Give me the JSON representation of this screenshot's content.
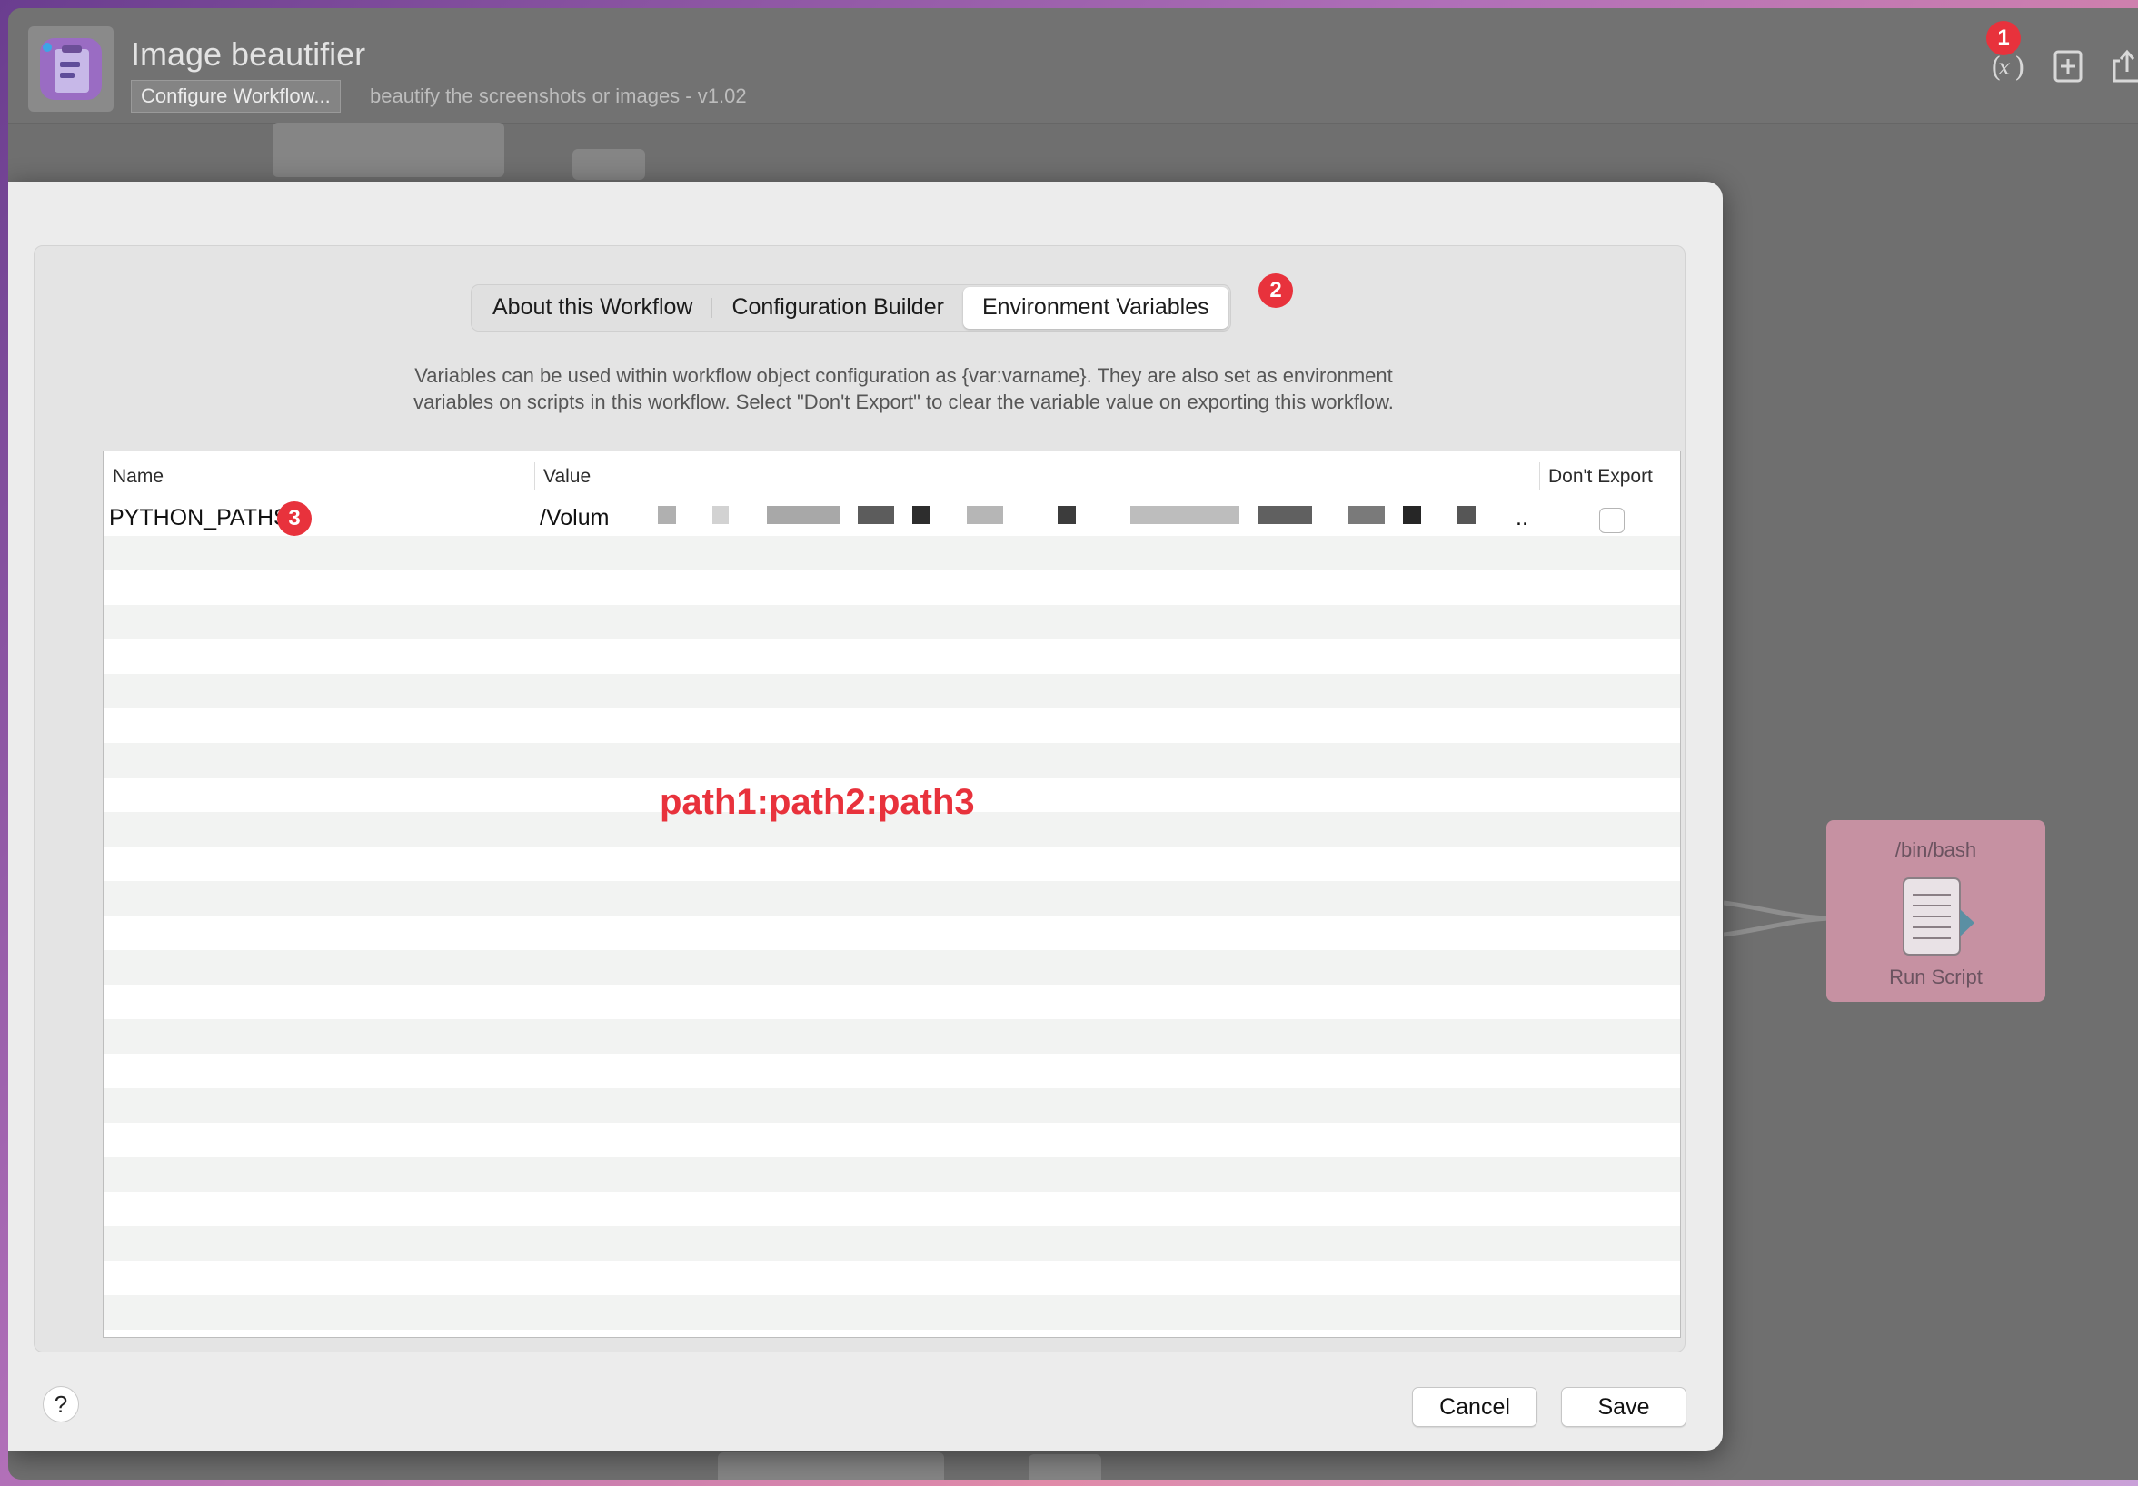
{
  "window": {
    "title": "Image beautifier",
    "configure_button": "Configure Workflow...",
    "subtitle": "beautify the screenshots or images - v1.02",
    "badges": {
      "b1": "1",
      "b2": "2",
      "b3": "3"
    }
  },
  "canvas": {
    "run_script": {
      "top_label": "/bin/bash",
      "bottom_label": "Run Script"
    }
  },
  "dialog": {
    "tabs": [
      {
        "label": "About this Workflow",
        "active": false
      },
      {
        "label": "Configuration Builder",
        "active": false
      },
      {
        "label": "Environment Variables",
        "active": true
      }
    ],
    "description_line1": "Variables can be used within workflow object configuration as {var:varname}. They are also set as environment",
    "description_line2": "variables on scripts in this workflow. Select \"Don't Export\" to clear the variable value on exporting this workflow.",
    "columns": {
      "name": "Name",
      "value": "Value",
      "dont_export": "Don't Export"
    },
    "rows": [
      {
        "name": "PYTHON_PATHS",
        "value_visible": "/Volum",
        "value_trailing": "..",
        "dont_export": false
      }
    ],
    "annotation": "path1:path2:path3",
    "add_symbol": "+",
    "remove_symbol": "—",
    "help_symbol": "?",
    "cancel_label": "Cancel",
    "save_label": "Save"
  },
  "colors": {
    "badge": "#e8323c",
    "accent_annotation": "#e8323c",
    "run_script_node": "#c691a2"
  }
}
